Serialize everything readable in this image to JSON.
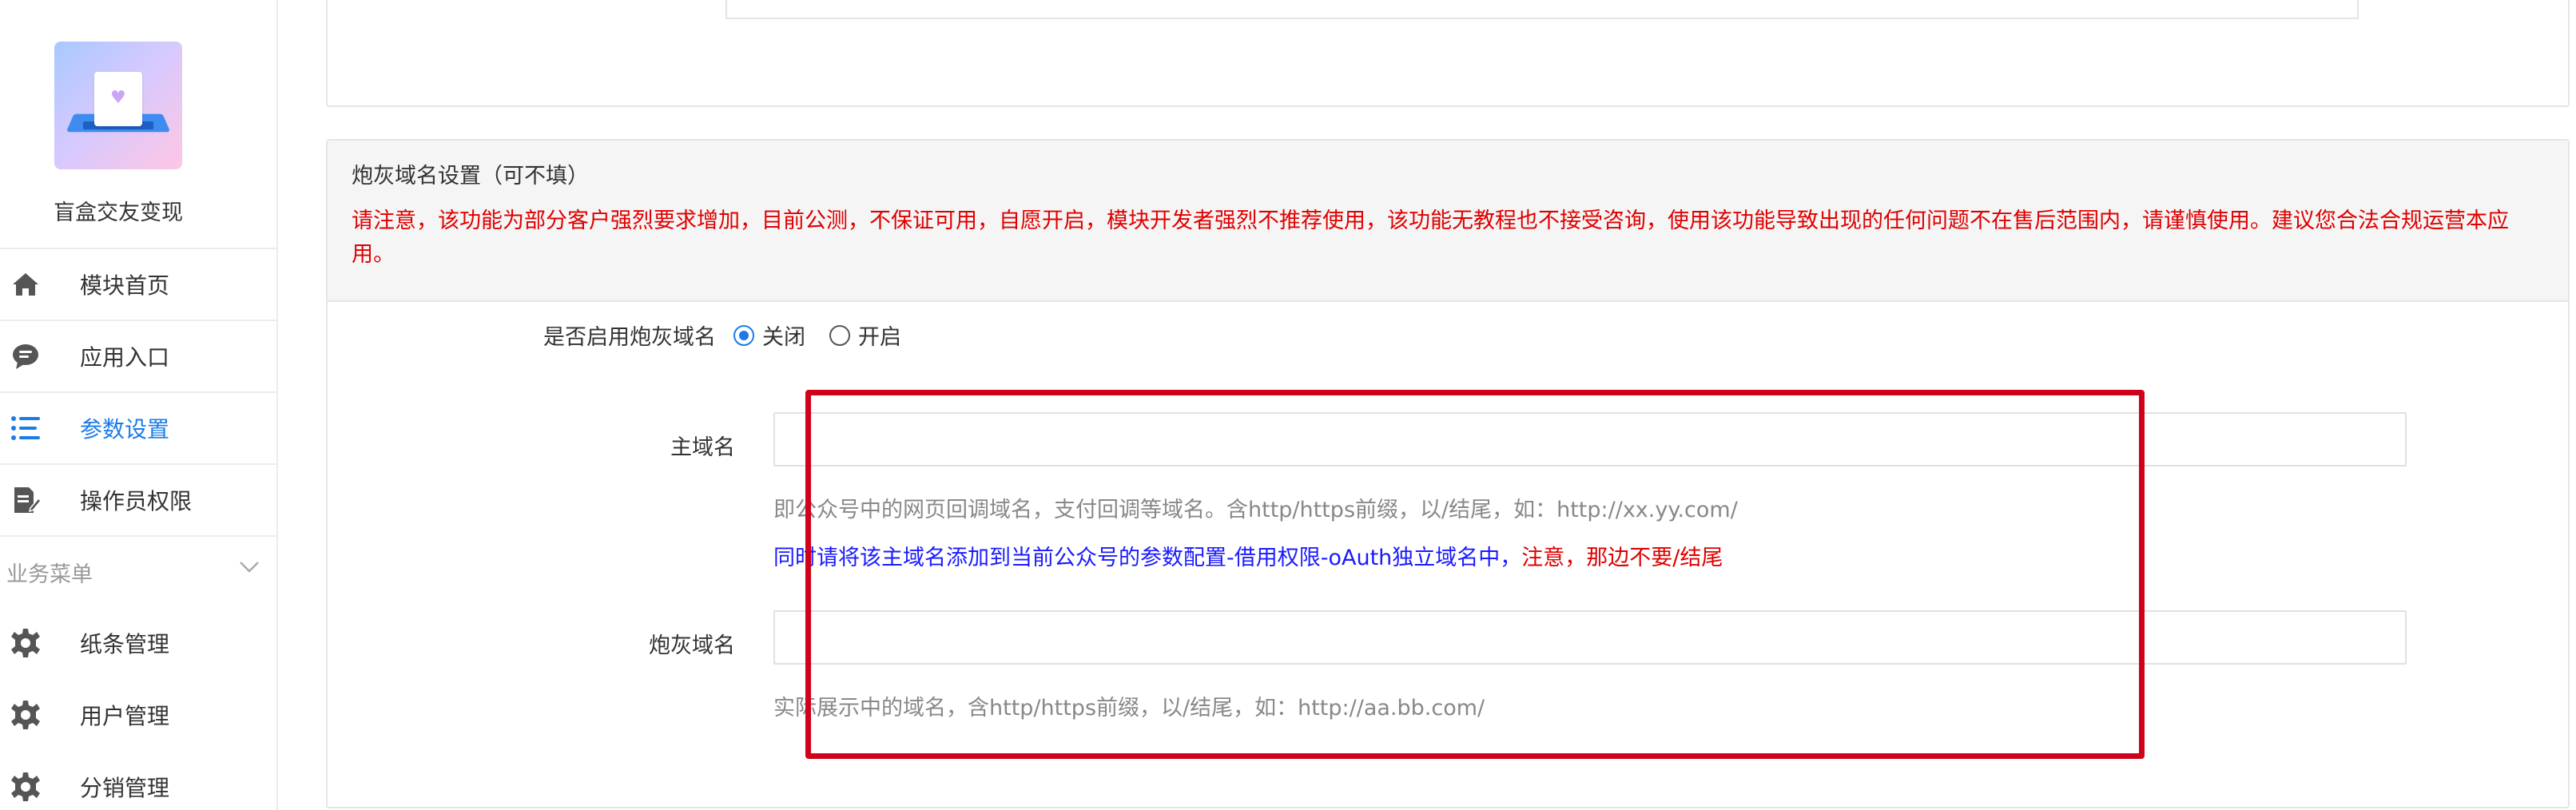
{
  "app": {
    "name": "盲盒交友变现"
  },
  "sidebar": {
    "items": [
      {
        "label": "模块首页",
        "icon": "home-icon"
      },
      {
        "label": "应用入口",
        "icon": "chat-icon"
      },
      {
        "label": "参数设置",
        "icon": "list-icon",
        "active": true
      },
      {
        "label": "操作员权限",
        "icon": "edit-doc-icon"
      }
    ],
    "section": {
      "label": "业务菜单",
      "icon": "chevron-down-icon"
    },
    "business_items": [
      {
        "label": "纸条管理",
        "icon": "gear-icon"
      },
      {
        "label": "用户管理",
        "icon": "gear-icon"
      },
      {
        "label": "分销管理",
        "icon": "gear-icon"
      }
    ]
  },
  "panel": {
    "title": "炮灰域名设置（可不填）",
    "warning": "请注意，该功能为部分客户强烈要求增加，目前公测，不保证可用，自愿开启，模块开发者强烈不推荐使用，该功能无教程也不接受咨询，使用该功能导致出现的任何问题不在售后范围内，请谨慎使用。建议您合法合规运营本应用。",
    "enable": {
      "label": "是否启用炮灰域名",
      "options": [
        "关闭",
        "开启"
      ],
      "selected": "关闭"
    },
    "main_domain": {
      "label": "主域名",
      "value": "",
      "help": "即公众号中的网页回调域名，支付回调等域名。含http/https前缀，以/结尾，如：http://xx.yy.com/",
      "note_blue": "同时请将该主域名添加到当前公众号的参数配置-借用权限-oAuth独立域名中，",
      "note_red": "注意，那边不要/结尾"
    },
    "cannon_domain": {
      "label": "炮灰域名",
      "value": "",
      "help": "实际展示中的域名，含http/https前缀，以/结尾，如：http://aa.bb.com/"
    }
  },
  "colors": {
    "accent": "#1b7ce8",
    "warning": "#e00000",
    "note_blue": "#1a1aff",
    "highlight": "#d0021b"
  }
}
